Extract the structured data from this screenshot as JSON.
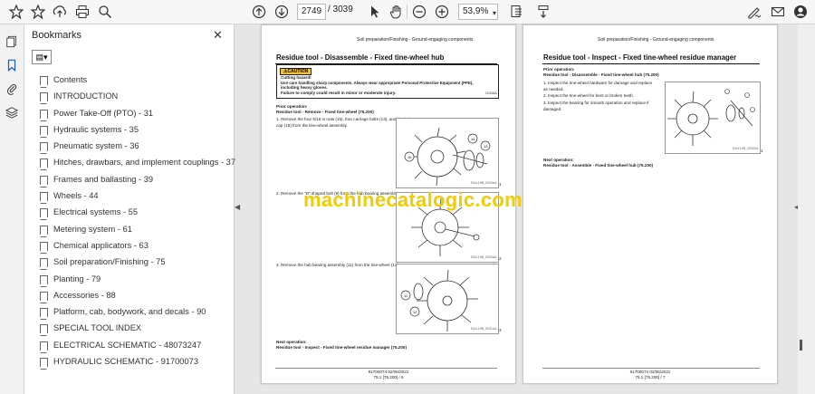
{
  "toolbar": {
    "page_current": "2749",
    "page_total": "/ 3039",
    "zoom": "53,9%",
    "icons": [
      "bookmark-star-icon",
      "upload-icon",
      "print-icon",
      "search-icon",
      "page-up-icon",
      "page-down-icon",
      "select-cursor-icon",
      "hand-tool-icon",
      "zoom-out-icon",
      "zoom-in-icon",
      "zoom-dropdown-icon",
      "fit-page-icon",
      "scroll-mode-icon",
      "sign-icon",
      "mail-icon",
      "account-icon"
    ]
  },
  "panel": {
    "title": "Bookmarks",
    "close": "✕",
    "tools_label": "▤▾",
    "items": [
      "Contents",
      "INTRODUCTION",
      "Power Take-Off (PTO) - 31",
      "Hydraulic systems - 35",
      "Pneumatic system - 36",
      "Hitches, drawbars, and implement couplings - 37",
      "Frames and ballasting - 39",
      "Wheels - 44",
      "Electrical systems - 55",
      "Metering system - 61",
      "Chemical applicators - 63",
      "Soil preparation/Finishing - 75",
      "Planting - 79",
      "Accessories - 88",
      "Platform, cab, bodywork, and decals - 90",
      "SPECIAL TOOL INDEX",
      "ELECTRICAL SCHEMATIC - 48073247",
      "HYDRAULIC SCHEMATIC - 91700073"
    ]
  },
  "page_left": {
    "header": "Soil preparation/Finishing - Ground-engaging components",
    "title": "Residue tool - Disassemble - Fixed tine-wheel hub",
    "caution_tag": "⚠CAUTION",
    "caution_l1": "Cutting hazard!",
    "caution_l2": "Use care handling sharp components. Always wear appropriate Personal Protective Equipment (PPE),",
    "caution_l3": "including heavy gloves.",
    "caution_l4": "Failure to comply could result in minor or moderate injury.",
    "caution_code": "C0138A",
    "prior_label": "Prior operation:",
    "prior_text": "Residue tool - Remove - Fixed tine-wheel (75.200)",
    "step1": "1.   Remove the four 5/16 in nuts (15), four carriage bolts (13), and the hub cap (16) from the tine-wheel assembly.",
    "step2": "2.   Remove the \"D\" shaped bolt (9) from the hub bearing assembly.",
    "step3": "3.   Remove the hub bearing assembly (11) from the tine-wheel (12).",
    "fig1_num": "1",
    "fig2_num": "2",
    "fig3_num": "3",
    "next_label": "Next operation:",
    "next_text": "Residue tool - Inspect - Fixed tine-wheel residue manager (75.200)",
    "footer1": "91700074 02/06/2021",
    "footer2": "75.1 [75.200] / 6"
  },
  "page_right": {
    "header": "Soil preparation/Finishing - Ground-engaging components",
    "title": "Residue tool - Inspect - Fixed tine-wheel residue manager",
    "prior_label": "Prior operation:",
    "prior_text": "Residue tool - Disassemble - Fixed tine-wheel hub (75.200)",
    "step1": "1.   Inspect the tine-wheel hardware for damage and replace as needed.",
    "step2": "2.   Inspect the tine-wheel for bent or broken teeth.",
    "step3": "3.   Inspect the bearing for smooth operation and replace if damaged.",
    "fig1_num": "1",
    "next_label": "Next operation:",
    "next_text": "Residue tool - Assemble - Fixed tine-wheel hub (75.200)",
    "footer1": "91700074 02/06/2021",
    "footer2": "75.1 [75.200] / 7"
  },
  "watermark": "machinecatalogic.com"
}
